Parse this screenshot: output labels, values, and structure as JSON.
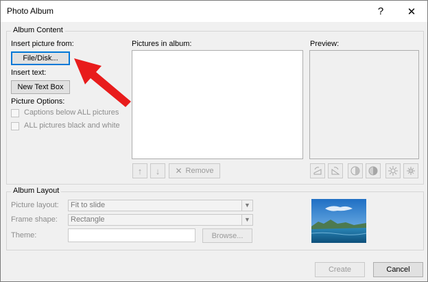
{
  "window": {
    "title": "Photo Album",
    "help_glyph": "?",
    "close_glyph": "✕"
  },
  "album_content": {
    "legend": "Album Content",
    "insert_picture_label": "Insert picture from:",
    "file_disk_button": "File/Disk...",
    "insert_text_label": "Insert text:",
    "new_text_box_button": "New Text Box",
    "picture_options_label": "Picture Options:",
    "captions_checkbox": "Captions below ALL pictures",
    "black_white_checkbox": "ALL pictures black and white",
    "pictures_in_album_label": "Pictures in album:",
    "move_up_glyph": "↑",
    "move_down_glyph": "↓",
    "remove_button": "Remove",
    "preview_label": "Preview:",
    "preview_tools": [
      "rotate-left-icon",
      "rotate-right-icon",
      "contrast-up-icon",
      "contrast-down-icon",
      "brightness-up-icon",
      "brightness-down-icon"
    ]
  },
  "album_layout": {
    "legend": "Album Layout",
    "picture_layout_label": "Picture layout:",
    "picture_layout_value": "Fit to slide",
    "frame_shape_label": "Frame shape:",
    "frame_shape_value": "Rectangle",
    "theme_label": "Theme:",
    "theme_value": "",
    "browse_button": "Browse..."
  },
  "footer": {
    "create_button": "Create",
    "cancel_button": "Cancel"
  },
  "colors": {
    "annotation_arrow": "#e81c1c",
    "focus_border": "#0078d7"
  }
}
